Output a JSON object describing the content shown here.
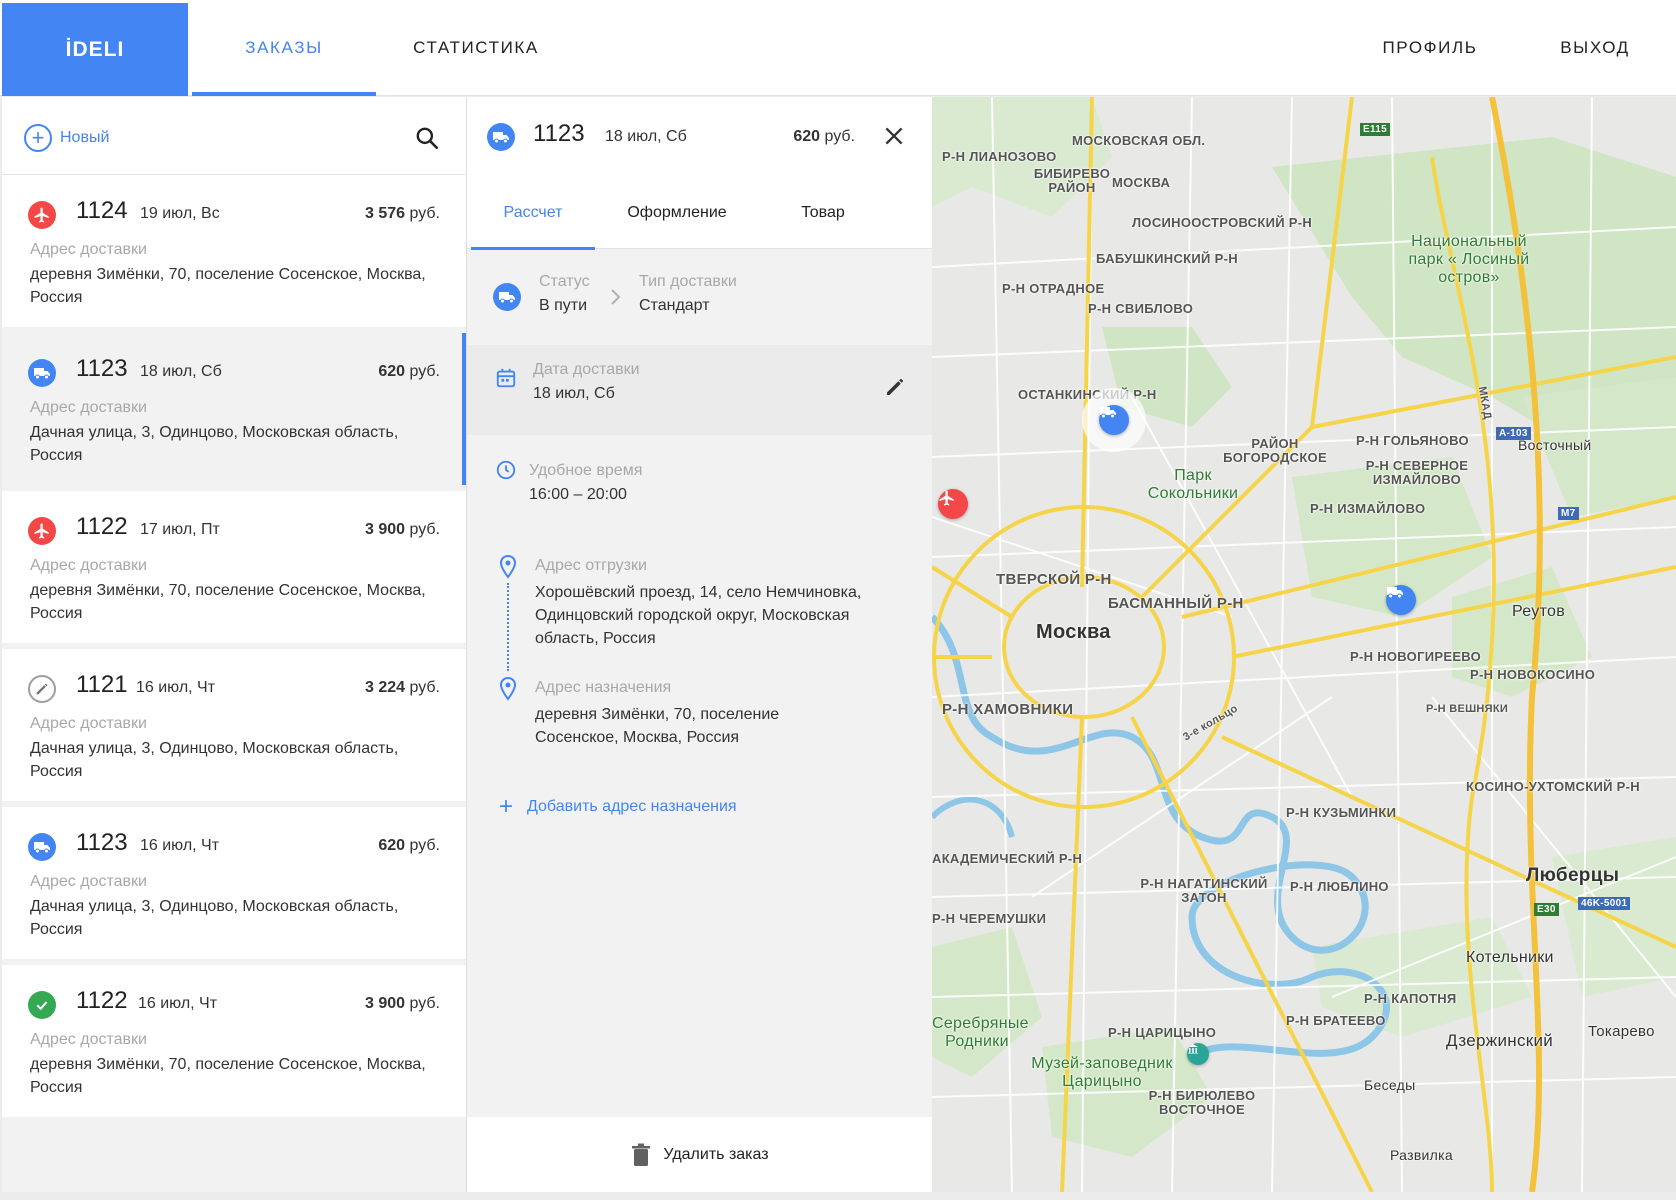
{
  "app": {
    "logo": "İDELI"
  },
  "nav": {
    "orders": "ЗАКАЗЫ",
    "statistics": "СТАТИСТИКА",
    "profile": "ПРОФИЛЬ",
    "logout": "ВЫХОД"
  },
  "list": {
    "new_label": "Новый",
    "orders": [
      {
        "icon": "airplane-icon",
        "icon_color": "#f44848",
        "number": "1124",
        "date": "19 июл, Вс",
        "price_value": "3 576",
        "currency": "руб.",
        "addr_label": "Адрес доставки",
        "address": "деревня Зимёнки, 70, поселение Сосенское, Москва, Россия"
      },
      {
        "icon": "truck-icon",
        "icon_color": "#4485f4",
        "number": "1123",
        "date": "18 июл, Сб",
        "price_value": "620",
        "currency": "руб.",
        "addr_label": "Адрес доставки",
        "address": "Дачная улица, 3, Одинцово, Московская область, Россия"
      },
      {
        "icon": "airplane-icon",
        "icon_color": "#f44848",
        "number": "1122",
        "date": "17 июл, Пт",
        "price_value": "3 900",
        "currency": "руб.",
        "addr_label": "Адрес доставки",
        "address": "деревня Зимёнки, 70, поселение Сосенское, Москва, Россия"
      },
      {
        "icon": "pencil-icon",
        "icon_color": "#9e9e9e",
        "number": "1121",
        "date": "16 июл, Чт",
        "price_value": "3 224",
        "currency": "руб.",
        "addr_label": "Адрес доставки",
        "address": "Дачная улица, 3, Одинцово, Московская область, Россия"
      },
      {
        "icon": "truck-icon",
        "icon_color": "#4485f4",
        "number": "1123",
        "date": "16 июл, Чт",
        "price_value": "620",
        "currency": "руб.",
        "addr_label": "Адрес доставки",
        "address": "Дачная улица, 3, Одинцово, Московская область, Россия"
      },
      {
        "icon": "check-icon",
        "icon_color": "#34a853",
        "number": "1122",
        "date": "16 июл, Чт",
        "price_value": "3 900",
        "currency": "руб.",
        "addr_label": "Адрес доставки",
        "address": "деревня Зимёнки, 70, поселение Сосенское, Москва, Россия"
      }
    ]
  },
  "detail": {
    "number": "1123",
    "date": "18 июл, Сб",
    "price_value": "620",
    "currency": "руб.",
    "tabs": [
      "Рассчет",
      "Оформление",
      "Товар"
    ],
    "status_label": "Статус",
    "status_value": "В пути",
    "delivery_type_label": "Тип доставки",
    "delivery_type_value": "Стандарт",
    "delivery_date_label": "Дата доставки",
    "delivery_date_value": "18 июл, Сб",
    "time_label": "Удобное время",
    "time_value": "16:00 – 20:00",
    "pickup_label": "Адрес отгрузки",
    "pickup_value": "Хорошёвский проезд, 14, село Немчиновка, Одинцовский городской округ, Московская область, Россия",
    "dest_label": "Адрес назначения",
    "dest_value": "деревня Зимёнки, 70, поселение Сосенское, Москва, Россия",
    "add_dest": "Добавить адрес назначения",
    "delete": "Удалить заказ"
  },
  "map": {
    "labels": {
      "mo": "МОСКОВСКАЯ ОБЛ.",
      "lianozovo": "Р-Н ЛИАНОЗОВО",
      "bibirevo": "БИБИРЕВО РАЙОН",
      "moskva_small": "МОСКВА",
      "losino": "ЛОСИНООСТРОВСКИЙ Р-Н",
      "babush": "БАБУШКИНСКИЙ Р-Н",
      "otradnoe": "Р-Н ОТРАДНОЕ",
      "sviblovo": "Р-Н СВИБЛОВО",
      "ostankino": "ОСТАНКИНСКИЙ Р-Н",
      "bogorodskoe": "РАЙОН БОГОРОДСКОЕ",
      "golyanovo": "Р-Н ГОЛЬЯНОВО",
      "sev_izm": "Р-Н СЕВЕРНОЕ ИЗМАЙЛОВО",
      "izmailovo": "Р-Н ИЗМАЙЛОВО",
      "vostochny": "Восточный",
      "tverskoy": "ТВЕРСКОЙ Р-Н",
      "basmanny": "БАСМАННЫЙ Р-Н",
      "moskva": "Москва",
      "khamovniki": "Р-Н ХАМОВНИКИ",
      "novogireevo": "Р-Н НОВОГИРЕЕВО",
      "novokosino": "Р-Н НОВОКОСИНО",
      "reutov": "Реутов",
      "veshnyaki": "Р-Н ВЕШНЯКИ",
      "kosino": "КОСИНО-УХТОМСКИЙ Р-Н",
      "kuzminki": "Р-Н КУЗЬМИНКИ",
      "akadem": "АКАДЕМИЧЕСКИЙ Р-Н",
      "nagatino": "Р-Н НАГАТИНСКИЙ ЗАТОН",
      "lyublino": "Р-Н ЛЮБЛИНО",
      "lyubertsy": "Люберцы",
      "cheremushki": "Р-Н ЧЕРЕМУШКИ",
      "kotelniki": "Котельники",
      "kapotnya": "Р-Н КАПОТНЯ",
      "brateevo": "Р-Н БРАТЕЕВО",
      "tsaritsyno": "Р-Н ЦАРИЦЫНО",
      "dzerzhinsky": "Дзержинский",
      "tokarevo": "Токарево",
      "biryulevo": "Р-Н БИРЮЛЕВО ВОСТОЧНОЕ",
      "besedy": "Беседы",
      "razvilka": "Развилка",
      "park_losiny": "Национальный парк « Лосиный остров»",
      "park_sokolniki": "Парк Сокольники",
      "museum": "Музей-заповедник Царицыно",
      "serebr": "Серебряные Родники",
      "mkad": "МКАД",
      "ring3": "3-е кольцо",
      "e115": "E115",
      "a103": "А-103",
      "m7": "M7",
      "e30": "E30",
      "r46": "46K-5001"
    }
  }
}
